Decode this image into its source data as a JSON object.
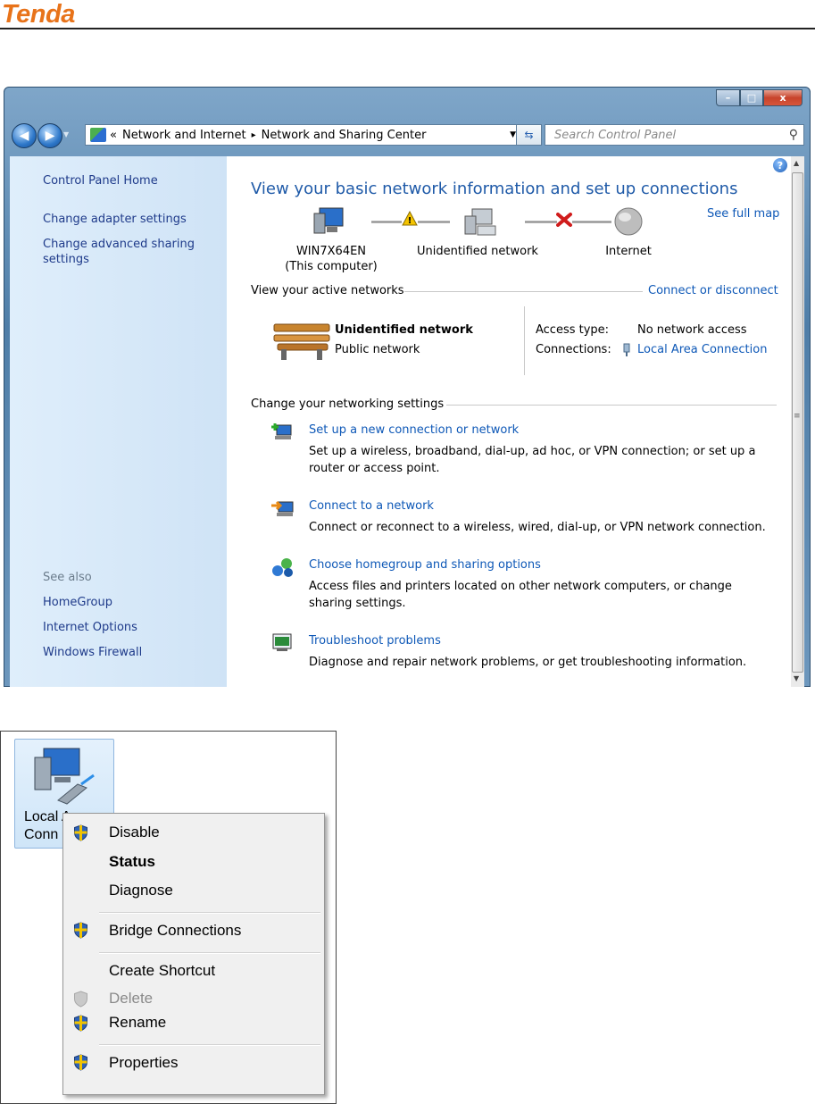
{
  "brand": {
    "logo_text": "Tenda"
  },
  "window": {
    "controls": {
      "minimize": "–",
      "maximize": "□",
      "close": "x"
    },
    "address": {
      "breadcrumb_prefix": "«",
      "crumb1": "Network and Internet",
      "separator": "▸",
      "crumb2": "Network and Sharing Center"
    },
    "search": {
      "placeholder": "Search Control Panel"
    }
  },
  "sidebar": {
    "items": [
      "Control Panel Home",
      "Change adapter settings",
      "Change advanced sharing settings"
    ],
    "see_also_label": "See also",
    "see_also": [
      "HomeGroup",
      "Internet Options",
      "Windows Firewall"
    ]
  },
  "main": {
    "title": "View your basic network information and set up connections",
    "see_full_map": "See full map",
    "map": {
      "computer_name": "WIN7X64EN",
      "computer_sub": "(This computer)",
      "network_name": "Unidentified network",
      "internet": "Internet"
    },
    "active_header": "View your active networks",
    "connect_disconnect": "Connect or disconnect",
    "active": {
      "name": "Unidentified network",
      "category": "Public network",
      "access_type_label": "Access type:",
      "access_type_value": "No network access",
      "connections_label": "Connections:",
      "connections_value": "Local Area Connection"
    },
    "settings_header": "Change your networking settings",
    "tasks": [
      {
        "title": "Set up a new connection or network",
        "desc": "Set up a wireless, broadband, dial-up, ad hoc, or VPN connection; or set up a router or access point."
      },
      {
        "title": "Connect to a network",
        "desc": "Connect or reconnect to a wireless, wired, dial-up, or VPN network connection."
      },
      {
        "title": "Choose homegroup and sharing options",
        "desc": "Access files and printers located on other network computers, or change sharing settings."
      },
      {
        "title": "Troubleshoot problems",
        "desc": "Diagnose and repair network problems, or get troubleshooting information."
      }
    ],
    "help": "?"
  },
  "adapter": {
    "label_line1": "Local A",
    "label_line2": "Conn",
    "menu": [
      "Disable",
      "Status",
      "Diagnose",
      "Bridge Connections",
      "Create Shortcut",
      "Delete",
      "Rename",
      "Properties"
    ]
  },
  "colors": {
    "link": "#0e58b7",
    "title": "#1f5aa8",
    "brand": "#e8731a",
    "sidebar": "#dfeefb"
  }
}
